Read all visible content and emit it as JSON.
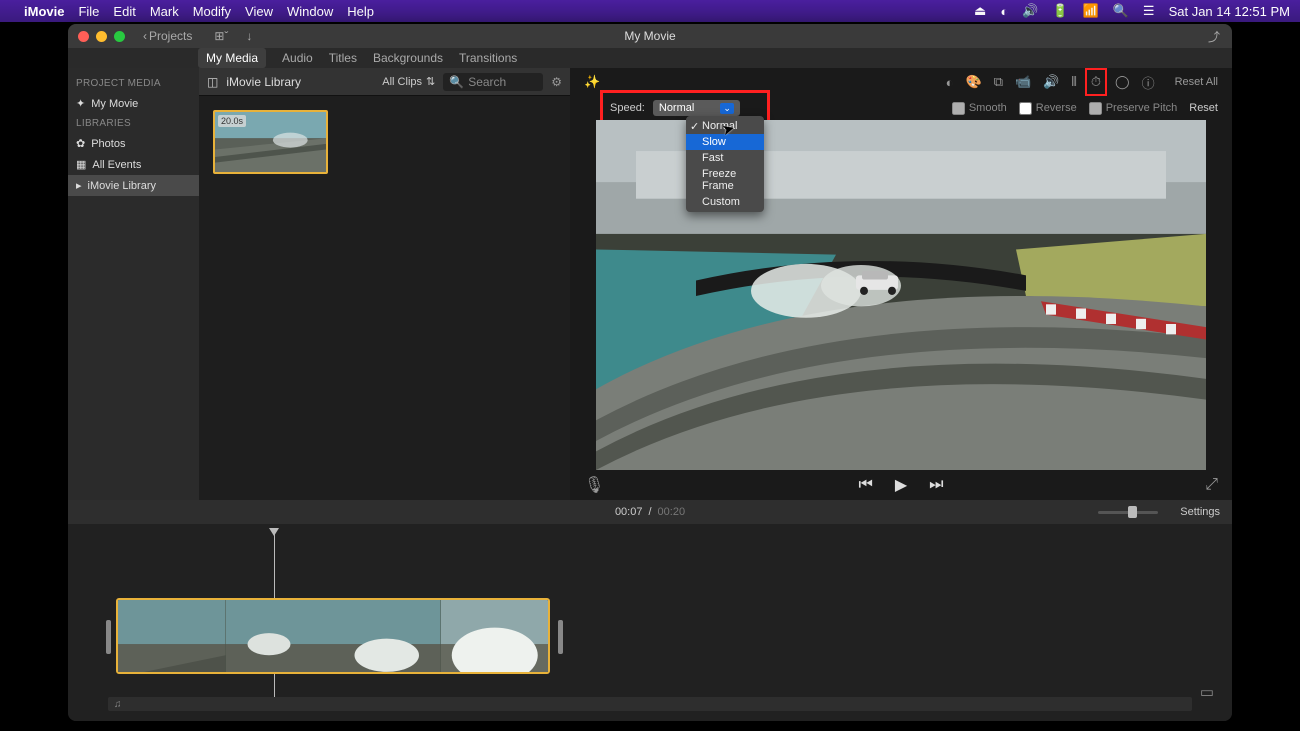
{
  "menubar": {
    "app": "iMovie",
    "items": [
      "File",
      "Edit",
      "Mark",
      "Modify",
      "View",
      "Window",
      "Help"
    ],
    "datetime": "Sat Jan 14  12:51 PM"
  },
  "window": {
    "title": "My Movie",
    "back_label": "Projects"
  },
  "tabs": {
    "items": [
      "My Media",
      "Audio",
      "Titles",
      "Backgrounds",
      "Transitions"
    ],
    "active": "My Media"
  },
  "sidebar": {
    "project_hdr": "PROJECT MEDIA",
    "project_item": "My Movie",
    "libraries_hdr": "LIBRARIES",
    "photos": "Photos",
    "all_events": "All Events",
    "imovie_lib": "iMovie Library"
  },
  "browser": {
    "library_label": "iMovie Library",
    "clips_label": "All Clips",
    "search_placeholder": "Search",
    "thumb_duration": "20.0s"
  },
  "viewer_toolbar": {
    "reset_all": "Reset All"
  },
  "speed": {
    "label": "Speed:",
    "selected": "Normal",
    "options": [
      "Normal",
      "Slow",
      "Fast",
      "Freeze Frame",
      "Custom"
    ],
    "checked": "Normal",
    "highlighted": "Slow",
    "smooth": "Smooth",
    "reverse": "Reverse",
    "preserve": "Preserve Pitch",
    "reset": "Reset"
  },
  "transport": {
    "current": "00:07",
    "sep": "/",
    "duration": "00:20",
    "settings": "Settings"
  }
}
